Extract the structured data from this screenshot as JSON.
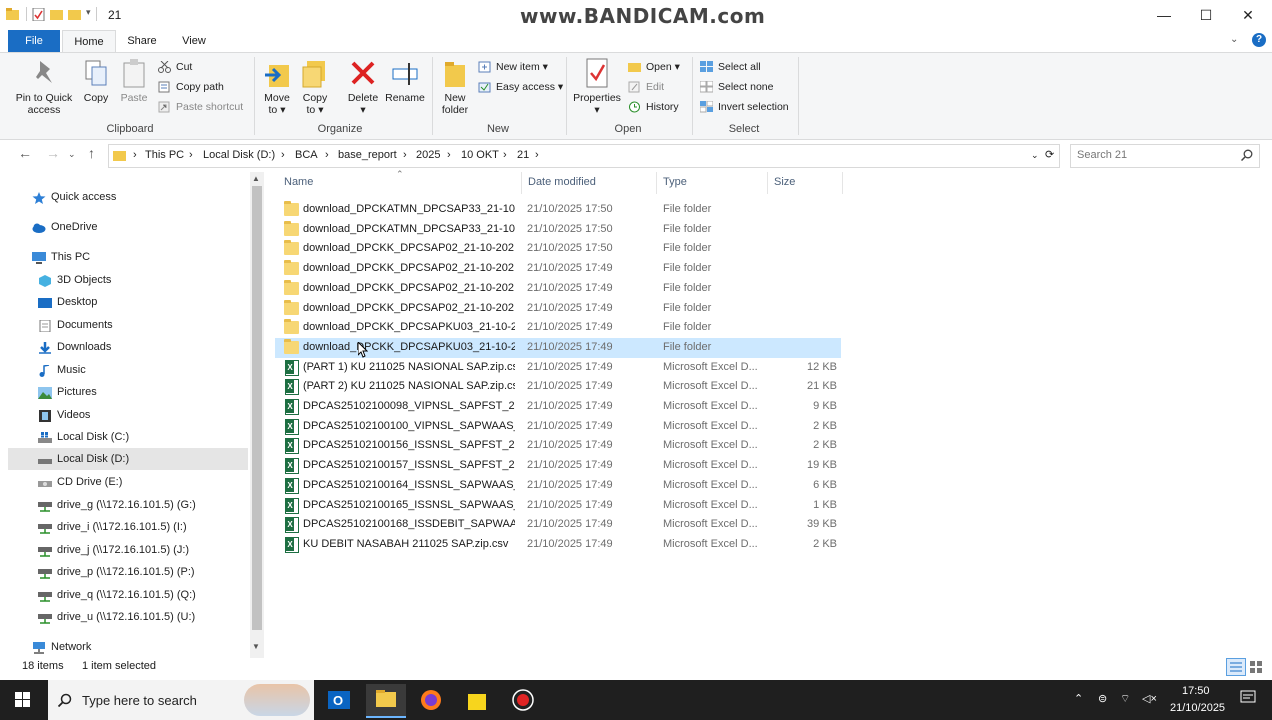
{
  "window": {
    "title": "21",
    "watermark": "www.BANDICAM.com",
    "minimize": "—",
    "maximize": "☐",
    "close": "✕",
    "help": "?"
  },
  "ribbon": {
    "tabs": [
      "File",
      "Home",
      "Share",
      "View"
    ],
    "clipboard": {
      "label": "Clipboard",
      "pin": "Pin to Quick access",
      "copy": "Copy",
      "paste": "Paste",
      "cut": "Cut",
      "copy_path": "Copy path",
      "paste_shortcut": "Paste shortcut"
    },
    "organize": {
      "label": "Organize",
      "move_to": "Move to",
      "copy_to": "Copy to",
      "delete": "Delete",
      "rename": "Rename"
    },
    "new": {
      "label": "New",
      "new_folder": "New folder",
      "new_item": "New item",
      "easy_access": "Easy access"
    },
    "open": {
      "label": "Open",
      "properties": "Properties",
      "open": "Open",
      "edit": "Edit",
      "history": "History"
    },
    "select": {
      "label": "Select",
      "select_all": "Select all",
      "select_none": "Select none",
      "invert": "Invert selection"
    }
  },
  "address": {
    "crumbs": [
      "This PC",
      "Local Disk (D:)",
      "BCA",
      "base_report",
      "2025",
      "10 OKT",
      "21"
    ],
    "search_placeholder": "Search 21"
  },
  "nav": {
    "quick_access": "Quick access",
    "onedrive": "OneDrive",
    "this_pc": "This PC",
    "items": [
      "3D Objects",
      "Desktop",
      "Documents",
      "Downloads",
      "Music",
      "Pictures",
      "Videos",
      "Local Disk (C:)",
      "Local Disk (D:)",
      "CD Drive (E:)"
    ],
    "drives": [
      "drive_g (\\\\172.16.101.5) (G:)",
      "drive_i (\\\\172.16.101.5) (I:)",
      "drive_j (\\\\172.16.101.5) (J:)",
      "drive_p (\\\\172.16.101.5) (P:)",
      "drive_q (\\\\172.16.101.5) (Q:)",
      "drive_u (\\\\172.16.101.5) (U:)"
    ],
    "network": "Network"
  },
  "columns": {
    "name": "Name",
    "date": "Date modified",
    "type": "Type",
    "size": "Size"
  },
  "files": [
    {
      "name": "download_DPCKATMN_DPCSAP33_21-10...",
      "date": "21/10/2025 17:50",
      "type": "File folder",
      "size": "",
      "kind": "folder"
    },
    {
      "name": "download_DPCKATMN_DPCSAP33_21-10...",
      "date": "21/10/2025 17:50",
      "type": "File folder",
      "size": "",
      "kind": "folder"
    },
    {
      "name": "download_DPCKK_DPCSAP02_21-10-202...",
      "date": "21/10/2025 17:50",
      "type": "File folder",
      "size": "",
      "kind": "folder"
    },
    {
      "name": "download_DPCKK_DPCSAP02_21-10-202...",
      "date": "21/10/2025 17:49",
      "type": "File folder",
      "size": "",
      "kind": "folder"
    },
    {
      "name": "download_DPCKK_DPCSAP02_21-10-202...",
      "date": "21/10/2025 17:49",
      "type": "File folder",
      "size": "",
      "kind": "folder"
    },
    {
      "name": "download_DPCKK_DPCSAP02_21-10-202...",
      "date": "21/10/2025 17:49",
      "type": "File folder",
      "size": "",
      "kind": "folder"
    },
    {
      "name": "download_DPCKK_DPCSAPKU03_21-10-2...",
      "date": "21/10/2025 17:49",
      "type": "File folder",
      "size": "",
      "kind": "folder"
    },
    {
      "name": "download_DPCKK_DPCSAPKU03_21-10-2...",
      "date": "21/10/2025 17:49",
      "type": "File folder",
      "size": "",
      "kind": "folder"
    },
    {
      "name": "(PART 1) KU 211025 NASIONAL SAP.zip.csv",
      "date": "21/10/2025 17:49",
      "type": "Microsoft Excel D...",
      "size": "12 KB",
      "kind": "excel"
    },
    {
      "name": "(PART 2) KU 211025 NASIONAL SAP.zip.csv",
      "date": "21/10/2025 17:49",
      "type": "Microsoft Excel D...",
      "size": "21 KB",
      "kind": "excel"
    },
    {
      "name": "DPCAS25102100098_VIPNSL_SAPFST_211...",
      "date": "21/10/2025 17:49",
      "type": "Microsoft Excel D...",
      "size": "9 KB",
      "kind": "excel"
    },
    {
      "name": "DPCAS25102100100_VIPNSL_SAPWAAS_2...",
      "date": "21/10/2025 17:49",
      "type": "Microsoft Excel D...",
      "size": "2 KB",
      "kind": "excel"
    },
    {
      "name": "DPCAS25102100156_ISSNSL_SAPFST_2110...",
      "date": "21/10/2025 17:49",
      "type": "Microsoft Excel D...",
      "size": "2 KB",
      "kind": "excel"
    },
    {
      "name": "DPCAS25102100157_ISSNSL_SAPFST_2110...",
      "date": "21/10/2025 17:49",
      "type": "Microsoft Excel D...",
      "size": "19 KB",
      "kind": "excel"
    },
    {
      "name": "DPCAS25102100164_ISSNSL_SAPWAAS_2...",
      "date": "21/10/2025 17:49",
      "type": "Microsoft Excel D...",
      "size": "6 KB",
      "kind": "excel"
    },
    {
      "name": "DPCAS25102100165_ISSNSL_SAPWAAS_2...",
      "date": "21/10/2025 17:49",
      "type": "Microsoft Excel D...",
      "size": "1 KB",
      "kind": "excel"
    },
    {
      "name": "DPCAS25102100168_ISSDEBIT_SAPWAAS_...",
      "date": "21/10/2025 17:49",
      "type": "Microsoft Excel D...",
      "size": "39 KB",
      "kind": "excel"
    },
    {
      "name": "KU DEBIT NASABAH 211025 SAP.zip.csv",
      "date": "21/10/2025 17:49",
      "type": "Microsoft Excel D...",
      "size": "2 KB",
      "kind": "excel"
    }
  ],
  "status": {
    "count": "18 items",
    "selected": "1 item selected"
  },
  "taskbar": {
    "search_placeholder": "Type here to search",
    "time": "17:50",
    "date": "21/10/2025"
  }
}
